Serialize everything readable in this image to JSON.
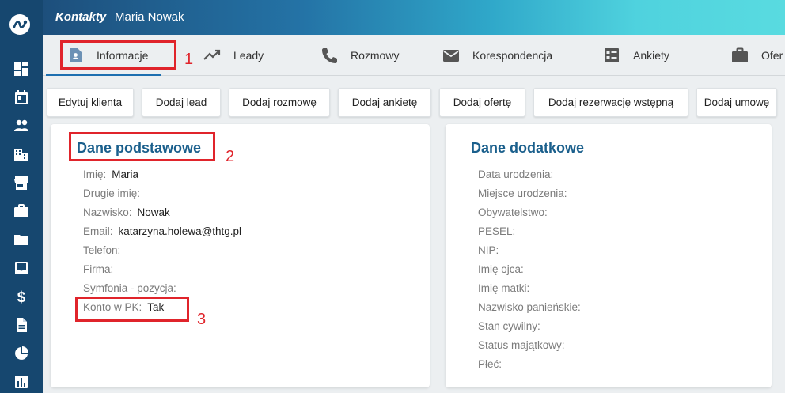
{
  "header": {
    "crumb": "Kontakty",
    "contact_name": "Maria Nowak"
  },
  "sidebar": {
    "icons": [
      "dashboard-icon",
      "calendar-icon",
      "people-icon",
      "building-icon",
      "store-icon",
      "briefcase-icon",
      "folder-icon",
      "inbox-icon",
      "dollar-icon",
      "document-icon",
      "pie-chart-icon",
      "bar-chart-icon"
    ]
  },
  "tabs": [
    {
      "label": "Informacje",
      "icon": "person-card-icon",
      "active": true
    },
    {
      "label": "Leady",
      "icon": "trending-up-icon"
    },
    {
      "label": "Rozmowy",
      "icon": "phone-icon"
    },
    {
      "label": "Korespondencja",
      "icon": "mail-icon"
    },
    {
      "label": "Ankiety",
      "icon": "list-icon"
    },
    {
      "label": "Ofer",
      "icon": "briefcase-icon"
    }
  ],
  "actions": [
    "Edytuj klienta",
    "Dodaj lead",
    "Dodaj rozmowę",
    "Dodaj ankietę",
    "Dodaj ofertę",
    "Dodaj rezerwację wstępną",
    "Dodaj umowę"
  ],
  "basic": {
    "title": "Dane podstawowe",
    "fields": [
      {
        "label": "Imię:",
        "value": "Maria"
      },
      {
        "label": "Drugie imię:",
        "value": ""
      },
      {
        "label": "Nazwisko:",
        "value": "Nowak"
      },
      {
        "label": "Email:",
        "value": "katarzyna.holewa@thtg.pl"
      },
      {
        "label": "Telefon:",
        "value": ""
      },
      {
        "label": "Firma:",
        "value": ""
      },
      {
        "label": "Symfonia - pozycja:",
        "value": ""
      },
      {
        "label": "Konto w PK:",
        "value": "Tak"
      }
    ]
  },
  "extra": {
    "title": "Dane dodatkowe",
    "fields": [
      {
        "label": "Data urodzenia:",
        "value": ""
      },
      {
        "label": "Miejsce urodzenia:",
        "value": ""
      },
      {
        "label": "Obywatelstwo:",
        "value": ""
      },
      {
        "label": "PESEL:",
        "value": ""
      },
      {
        "label": "NIP:",
        "value": ""
      },
      {
        "label": "Imię ojca:",
        "value": ""
      },
      {
        "label": "Imię matki:",
        "value": ""
      },
      {
        "label": "Nazwisko panieńskie:",
        "value": ""
      },
      {
        "label": "Stan cywilny:",
        "value": ""
      },
      {
        "label": "Status majątkowy:",
        "value": ""
      },
      {
        "label": "Płeć:",
        "value": ""
      }
    ]
  },
  "annotations": [
    "1",
    "2",
    "3"
  ],
  "colors": {
    "sidebar": "#16476f",
    "accent": "#1a5f8c",
    "annotation": "#e0242b"
  }
}
